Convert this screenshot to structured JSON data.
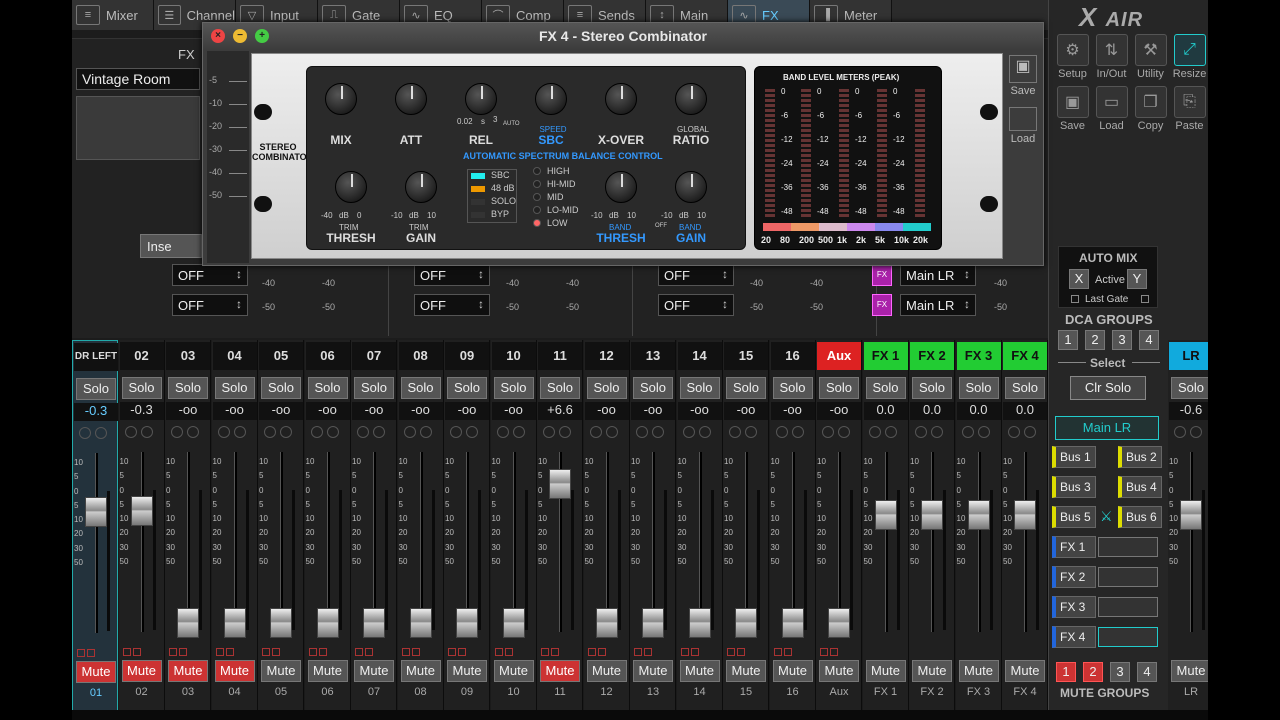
{
  "tabs": [
    {
      "label": "Mixer",
      "icon": "mixer-icon",
      "glyph": "≡"
    },
    {
      "label": "Channel",
      "icon": "channel-icon",
      "glyph": "☰"
    },
    {
      "label": "Input",
      "icon": "input-icon",
      "glyph": "▽"
    },
    {
      "label": "Gate",
      "icon": "gate-icon",
      "glyph": "⎍"
    },
    {
      "label": "EQ",
      "icon": "eq-icon",
      "glyph": "∿"
    },
    {
      "label": "Comp",
      "icon": "comp-icon",
      "glyph": "⌒"
    },
    {
      "label": "Sends",
      "icon": "sends-icon",
      "glyph": "≡"
    },
    {
      "label": "Main",
      "icon": "main-icon",
      "glyph": "↕"
    },
    {
      "label": "FX",
      "icon": "fx-icon",
      "glyph": "∿",
      "active": true
    },
    {
      "label": "Meter",
      "icon": "meter-icon",
      "glyph": "▐"
    }
  ],
  "brand": {
    "logo_x": "X",
    "logo_text": "AIR"
  },
  "tools": [
    {
      "label": "Setup",
      "icon": "gear-icon",
      "glyph": "⚙"
    },
    {
      "label": "In/Out",
      "icon": "in-out-icon",
      "glyph": "⇅"
    },
    {
      "label": "Utility",
      "icon": "wrench-icon",
      "glyph": "⚒"
    },
    {
      "label": "Resize",
      "icon": "resize-icon",
      "glyph": "⤢"
    },
    {
      "label": "Save",
      "icon": "save-icon",
      "glyph": "▣"
    },
    {
      "label": "Load",
      "icon": "folder-icon",
      "glyph": "▭"
    },
    {
      "label": "Copy",
      "icon": "copy-icon",
      "glyph": "❐"
    },
    {
      "label": "Paste",
      "icon": "paste-icon",
      "glyph": "⎘"
    }
  ],
  "fx": {
    "label": "FX",
    "preset": "Vintage Room",
    "insert": "Inse"
  },
  "window": {
    "title": "FX 4 - Stereo Combinator",
    "save": "Save",
    "load": "Load",
    "rack_name": "STEREO COMBINATOR",
    "knobs_top": [
      {
        "label": "MIX"
      },
      {
        "label": "ATT"
      },
      {
        "label": "REL"
      },
      {
        "label": "SBC",
        "sub": "SPEED"
      },
      {
        "label": "X-OVER"
      },
      {
        "label": "RATIO",
        "sub": "GLOBAL"
      }
    ],
    "rel_range": [
      "0.02",
      "s",
      "3",
      "AUTO"
    ],
    "sbc_caption": "AUTOMATIC SPECTRUM BALANCE CONTROL",
    "knobs_bottom": [
      {
        "label": "THRESH",
        "sub": "TRIM",
        "range": [
          "-40",
          "dB",
          "0"
        ]
      },
      {
        "label": "GAIN",
        "sub": "TRIM",
        "range": [
          "-10",
          "dB",
          "10"
        ]
      },
      {
        "label": "THRESH",
        "sub": "BAND",
        "range": [
          "-10",
          "dB",
          "10"
        ]
      },
      {
        "label": "GAIN",
        "sub": "BAND",
        "range": [
          "-10",
          "dB",
          "10"
        ]
      }
    ],
    "band_off": "OFF",
    "switches": [
      {
        "label": "SBC",
        "color": "#2ee"
      },
      {
        "label": "48 dB",
        "color": "#e90"
      },
      {
        "label": "SOLO",
        "color": "#333"
      },
      {
        "label": "BYP",
        "color": "#333"
      }
    ],
    "bands": [
      "HIGH",
      "HI-MID",
      "MID",
      "LO-MID",
      "LOW"
    ],
    "meter_title": "BAND LEVEL METERS (PEAK)",
    "meter_scale": [
      "0",
      "-6",
      "-12",
      "-24",
      "-36",
      "-48"
    ],
    "freq_labels": [
      "20",
      "80",
      "200",
      "500",
      "1k",
      "2k",
      "5k",
      "10k",
      "20k"
    ],
    "left_scale": [
      "-5",
      "-10",
      "-20",
      "-30",
      "-40",
      "-50"
    ]
  },
  "sends": [
    {
      "value": "OFF"
    },
    {
      "value": "OFF"
    },
    {
      "value": "OFF"
    },
    {
      "value": "OFF"
    },
    {
      "value": "OFF"
    },
    {
      "value": "OFF"
    }
  ],
  "send_dest": [
    "Main LR",
    "Main LR"
  ],
  "send_fx_badge": "FX",
  "send_scale": [
    "-40",
    "-50"
  ],
  "fader_scale": [
    "10",
    "5",
    "0",
    "5",
    "10",
    "20",
    "30",
    "50"
  ],
  "channels": [
    {
      "name": "DR LEFT",
      "gain": "-0.3",
      "label": "01",
      "mute_on": true,
      "fader": 0.74,
      "sel": true
    },
    {
      "name": "02",
      "gain": "-0.3",
      "label": "02",
      "mute_on": true,
      "fader": 0.74
    },
    {
      "name": "03",
      "gain": "-oo",
      "label": "03",
      "mute_on": true,
      "fader": 0.08
    },
    {
      "name": "04",
      "gain": "-oo",
      "label": "04",
      "mute_on": true,
      "fader": 0.08
    },
    {
      "name": "05",
      "gain": "-oo",
      "label": "05",
      "fader": 0.08
    },
    {
      "name": "06",
      "gain": "-oo",
      "label": "06",
      "fader": 0.08
    },
    {
      "name": "07",
      "gain": "-oo",
      "label": "07",
      "fader": 0.08
    },
    {
      "name": "08",
      "gain": "-oo",
      "label": "08",
      "fader": 0.08
    },
    {
      "name": "09",
      "gain": "-oo",
      "label": "09",
      "fader": 0.08
    },
    {
      "name": "10",
      "gain": "-oo",
      "label": "10",
      "fader": 0.08
    },
    {
      "name": "11",
      "gain": "+6.6",
      "label": "11",
      "mute_on": true,
      "fader": 0.9
    },
    {
      "name": "12",
      "gain": "-oo",
      "label": "12",
      "fader": 0.08
    },
    {
      "name": "13",
      "gain": "-oo",
      "label": "13",
      "fader": 0.08
    },
    {
      "name": "14",
      "gain": "-oo",
      "label": "14",
      "fader": 0.08
    },
    {
      "name": "15",
      "gain": "-oo",
      "label": "15",
      "fader": 0.08
    },
    {
      "name": "16",
      "gain": "-oo",
      "label": "16",
      "fader": 0.08
    },
    {
      "name": "Aux",
      "gain": "-oo",
      "label": "Aux",
      "fader": 0.08,
      "color": "#d22"
    },
    {
      "name": "FX 1",
      "gain": "0.0",
      "label": "FX 1",
      "fader": 0.72,
      "color": "#2c3"
    },
    {
      "name": "FX 2",
      "gain": "0.0",
      "label": "FX 2",
      "fader": 0.72,
      "color": "#2c3"
    },
    {
      "name": "FX 3",
      "gain": "0.0",
      "label": "FX 3",
      "fader": 0.72,
      "color": "#2c3"
    },
    {
      "name": "FX 4",
      "gain": "0.0",
      "label": "FX 4",
      "fader": 0.72,
      "color": "#2c3"
    }
  ],
  "solo_label": "Solo",
  "mute_label": "Mute",
  "automix": {
    "title": "AUTO MIX",
    "x": "X",
    "active": "Active",
    "y": "Y",
    "last_gate": "Last Gate"
  },
  "dca": {
    "title": "DCA GROUPS",
    "buttons": [
      "1",
      "2",
      "3",
      "4"
    ],
    "select": "Select",
    "clr_solo": "Clr Solo",
    "main_lr": "Main LR"
  },
  "buses": [
    "Bus 1",
    "Bus 2",
    "Bus 3",
    "Bus 4",
    "Bus 5",
    "Bus 6"
  ],
  "fxslots": [
    "FX 1",
    "FX 2",
    "FX 3",
    "FX 4"
  ],
  "mute_groups": {
    "title": "MUTE GROUPS",
    "buttons": [
      "1",
      "2",
      "3",
      "4"
    ]
  },
  "lr": {
    "name": "LR",
    "gain": "-0.6",
    "label": "LR",
    "fader": 0.72
  }
}
